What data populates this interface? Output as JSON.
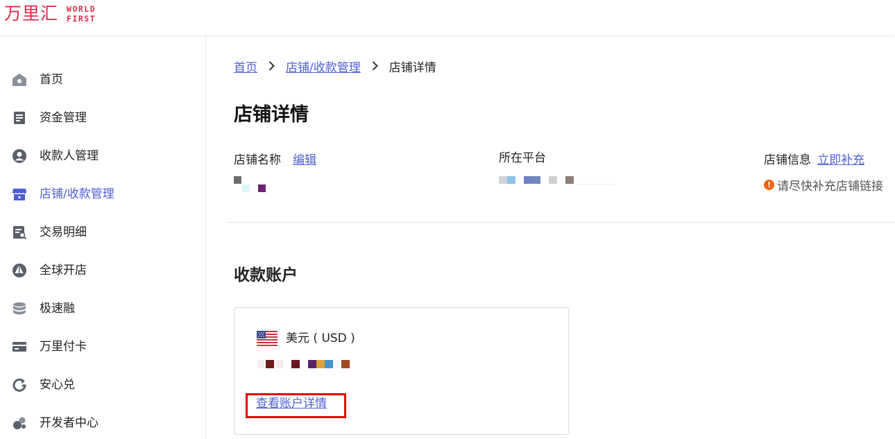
{
  "logo": {
    "cn": "万里汇",
    "en_line1": "WORLD",
    "en_line2": "FIRST"
  },
  "colors": {
    "brand": "#e6294a",
    "link": "#4c5fd7",
    "warning": "#f0650f",
    "highlight_box": "#e50000"
  },
  "sidebar": {
    "items": [
      {
        "label": "首页",
        "icon": "home-icon"
      },
      {
        "label": "资金管理",
        "icon": "document-icon"
      },
      {
        "label": "收款人管理",
        "icon": "user-icon"
      },
      {
        "label": "店铺/收款管理",
        "icon": "store-icon",
        "active": true
      },
      {
        "label": "交易明细",
        "icon": "transaction-search-icon"
      },
      {
        "label": "全球开店",
        "icon": "sailboat-icon"
      },
      {
        "label": "极速融",
        "icon": "database-icon"
      },
      {
        "label": "万里付卡",
        "icon": "card-icon"
      },
      {
        "label": "安心兑",
        "icon": "exchange-icon"
      },
      {
        "label": "开发者中心",
        "icon": "developer-icon"
      }
    ]
  },
  "breadcrumb": {
    "home": "首页",
    "parent": "店铺/收款管理",
    "current": "店铺详情"
  },
  "page": {
    "title": "店铺详情"
  },
  "store_info": {
    "name_label": "店铺名称",
    "edit_link": "编辑",
    "platform_label": "所在平台",
    "info_label": "店铺信息",
    "supplement_link": "立即补充",
    "warning_text": "请尽快补充店铺链接"
  },
  "accounts": {
    "section_title": "收款账户",
    "card": {
      "currency": "美元 ( USD )",
      "flag": "us-flag-icon",
      "details_link": "查看账户详情"
    }
  }
}
